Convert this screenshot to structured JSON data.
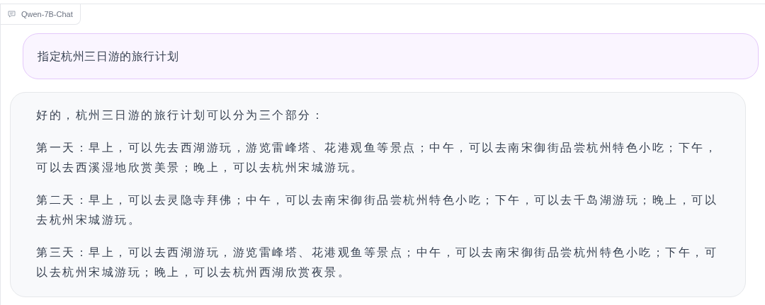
{
  "panel_label": {
    "text": "Qwen-7B-Chat"
  },
  "messages": [
    {
      "kind": "user",
      "paragraphs": [
        "指定杭州三日游的旅行计划"
      ]
    },
    {
      "kind": "bot",
      "paragraphs": [
        "好的，杭州三日游的旅行计划可以分为三个部分：",
        "第一天：早上，可以先去西湖游玩，游览雷峰塔、花港观鱼等景点；中午，可以去南宋御街品尝杭州特色小吃；下午，可以去西溪湿地欣赏美景；晚上，可以去杭州宋城游玩。",
        "第二天：早上，可以去灵隐寺拜佛；中午，可以去南宋御街品尝杭州特色小吃；下午，可以去千岛湖游玩；晚上，可以去杭州宋城游玩。",
        "第三天：早上，可以去西湖游玩，游览雷峰塔、花港观鱼等景点；中午，可以去南宋御街品尝杭州特色小吃；下午，可以去杭州宋城游玩；晚上，可以去杭州西湖欣赏夜景。"
      ]
    }
  ]
}
